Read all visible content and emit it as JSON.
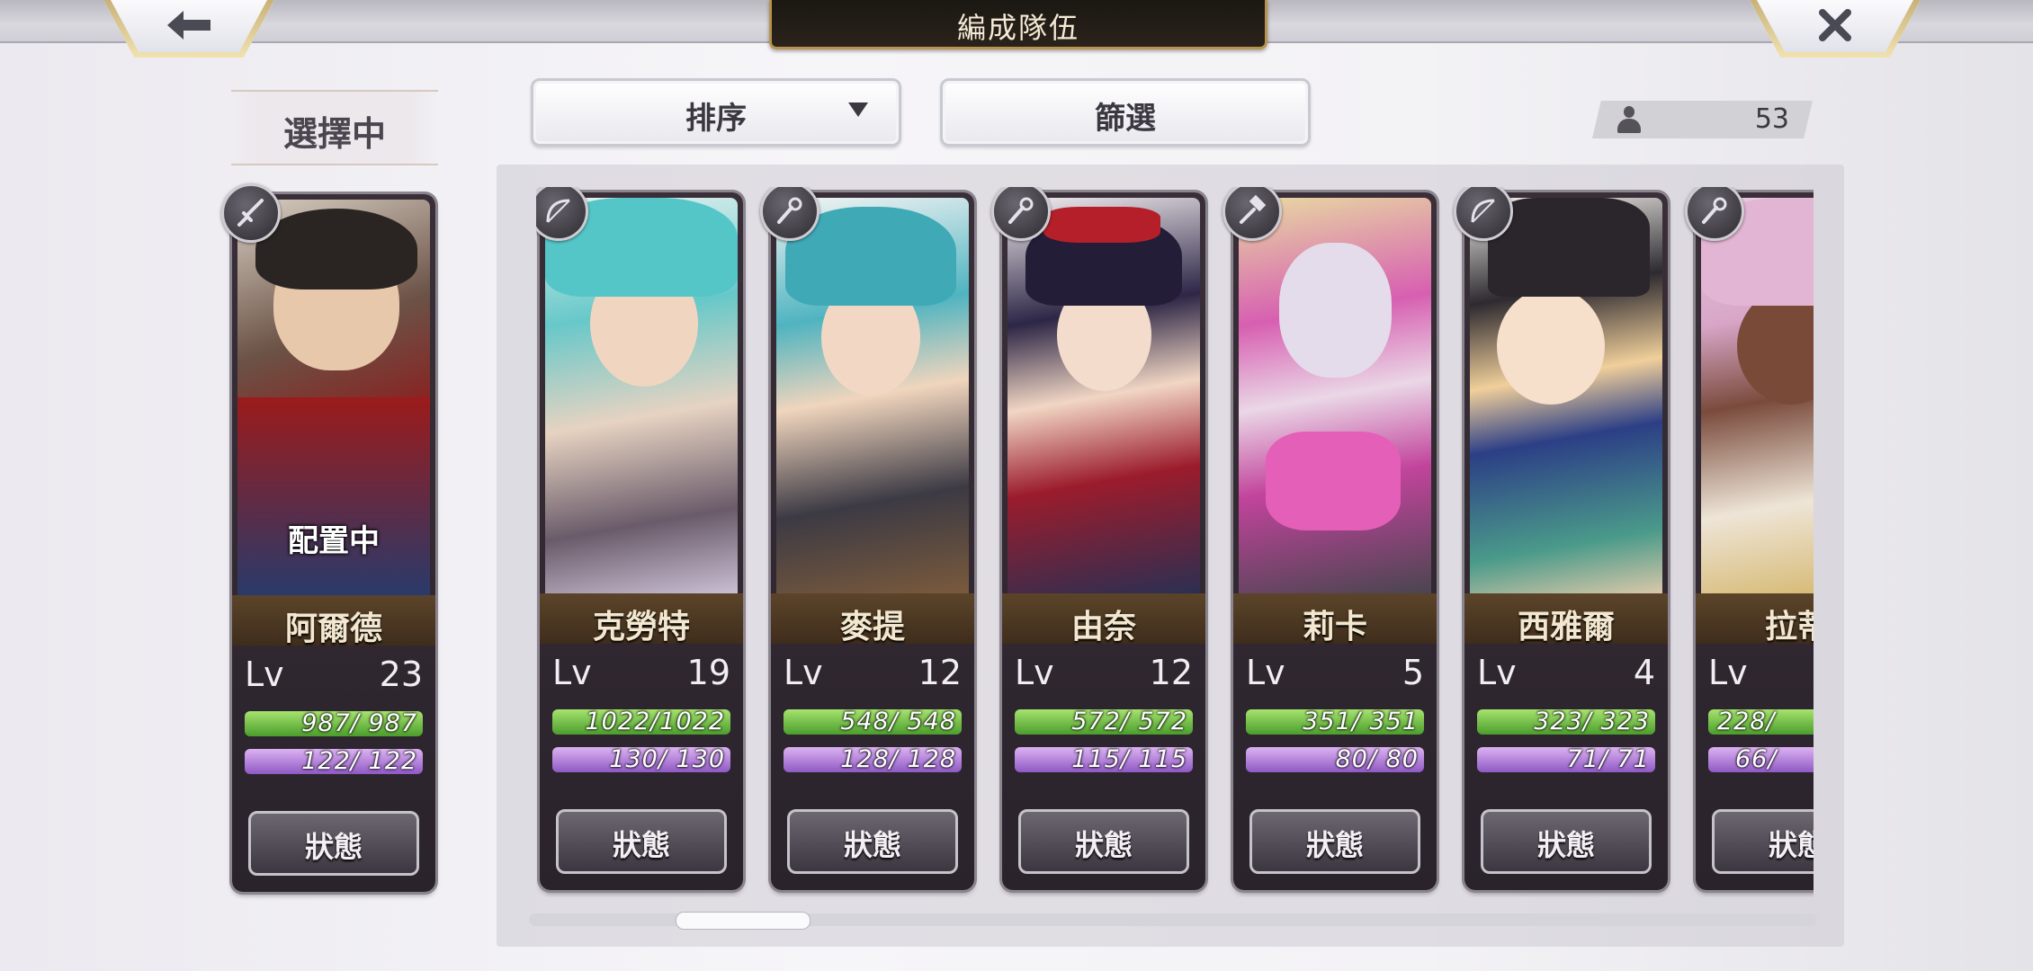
{
  "header": {
    "title": "編成隊伍",
    "back_icon": "back-arrow-icon",
    "close_icon": "close-icon"
  },
  "selected": {
    "label": "選擇中",
    "card": {
      "name": "阿爾德",
      "lv_label": "Lv",
      "level": "23",
      "hp": "987/ 987",
      "sp": "122/ 122",
      "status_label": "狀態",
      "assigned_label": "配置中",
      "weapon": "sword-icon"
    }
  },
  "toolbar": {
    "sort_label": "排序",
    "filter_label": "篩選",
    "unit_count": "53",
    "count_icon": "person-icon"
  },
  "roster": [
    {
      "name": "克勞特",
      "lv_label": "Lv",
      "level": "19",
      "hp": "1022/1022",
      "sp": "130/ 130",
      "status_label": "狀態",
      "weapon": "bow-icon"
    },
    {
      "name": "麥提",
      "lv_label": "Lv",
      "level": "12",
      "hp": "548/ 548",
      "sp": "128/ 128",
      "status_label": "狀態",
      "weapon": "staff-icon"
    },
    {
      "name": "由奈",
      "lv_label": "Lv",
      "level": "12",
      "hp": "572/ 572",
      "sp": "115/ 115",
      "status_label": "狀態",
      "weapon": "staff-icon"
    },
    {
      "name": "莉卡",
      "lv_label": "Lv",
      "level": "5",
      "hp": "351/ 351",
      "sp": "80/ 80",
      "status_label": "狀態",
      "weapon": "hammer-icon"
    },
    {
      "name": "西雅爾",
      "lv_label": "Lv",
      "level": "4",
      "hp": "323/ 323",
      "sp": "71/ 71",
      "status_label": "狀態",
      "weapon": "bow-icon"
    },
    {
      "name": "拉蒂",
      "lv_label": "Lv",
      "level": "",
      "hp": "228/",
      "sp": "66/",
      "status_label": "狀態",
      "weapon": "staff-icon"
    }
  ],
  "colors": {
    "hp_bar": "#6cc04a",
    "sp_bar": "#b886dc",
    "name_plate": "#4e3822",
    "title_plate": "#221c15",
    "gold_trim": "#b8924e"
  }
}
